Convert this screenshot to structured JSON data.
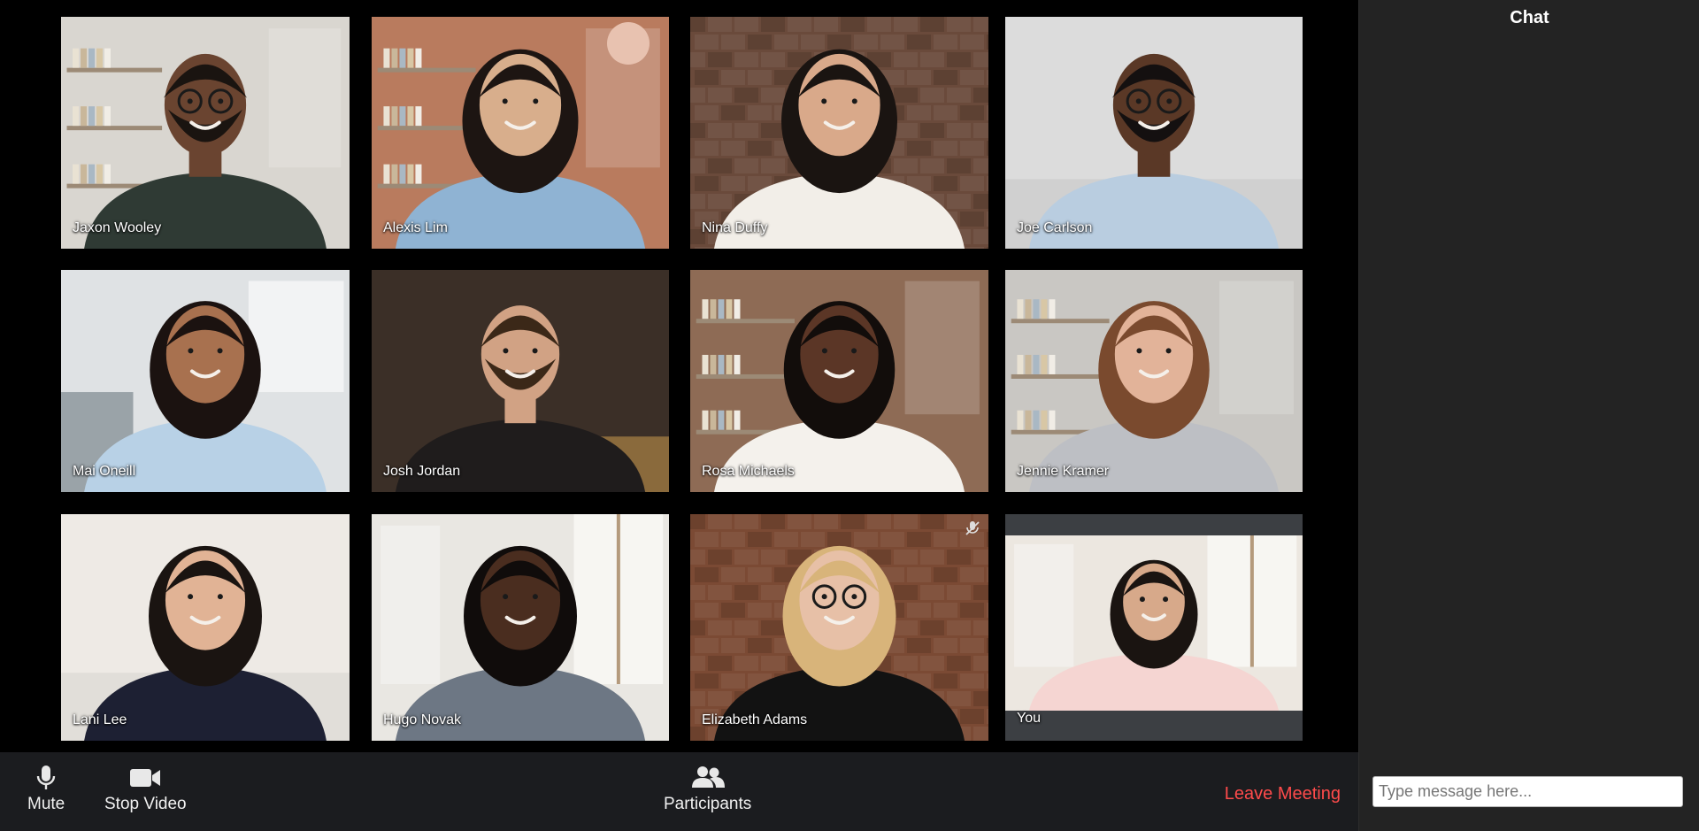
{
  "participants": [
    {
      "name": "Jaxon Wooley",
      "scene": "shelves",
      "bg": "#d9d6d0",
      "skin": "#6a4430",
      "shirt": "#2f3a34",
      "hair": "#1a1410",
      "glasses": true,
      "beard": true
    },
    {
      "name": "Alexis Lim",
      "scene": "bookcase",
      "bg": "#b97b5e",
      "skin": "#d8ae8c",
      "shirt": "#8fb3d3",
      "hair": "#1d1512",
      "glasses": false,
      "beard": false
    },
    {
      "name": "Nina Duffy",
      "scene": "brick",
      "bg": "#6a4a3b",
      "skin": "#d9a98a",
      "shirt": "#f2eee8",
      "hair": "#1a1411",
      "glasses": false,
      "beard": false
    },
    {
      "name": "Joe Carlson",
      "scene": "plain",
      "bg": "#dcdcdc",
      "skin": "#5a3826",
      "shirt": "#b9cde0",
      "hair": "#141010",
      "glasses": true,
      "beard": true
    },
    {
      "name": "Mai Oneill",
      "scene": "office",
      "bg": "#dfe2e4",
      "skin": "#a8714f",
      "shirt": "#b8d1e6",
      "hair": "#1b1210",
      "glasses": false,
      "beard": false
    },
    {
      "name": "Josh Jordan",
      "scene": "dark",
      "bg": "#3b2f27",
      "skin": "#d1a284",
      "shirt": "#1f1c1c",
      "hair": "#3b2818",
      "glasses": false,
      "beard": true
    },
    {
      "name": "Rosa Michaels",
      "scene": "bookcase",
      "bg": "#8e6b55",
      "skin": "#5b3626",
      "shirt": "#f4f1ec",
      "hair": "#120d0b",
      "glasses": false,
      "beard": false
    },
    {
      "name": "Jennie Kramer",
      "scene": "shelves",
      "bg": "#c9c7c3",
      "skin": "#e2b399",
      "shirt": "#bdbfc4",
      "hair": "#7a4a2e",
      "glasses": false,
      "beard": false
    },
    {
      "name": "Lani Lee",
      "scene": "plain",
      "bg": "#eeeae5",
      "skin": "#e1b395",
      "shirt": "#1d2033",
      "hair": "#1a1411",
      "glasses": false,
      "beard": false
    },
    {
      "name": "Hugo Novak",
      "scene": "window",
      "bg": "#e9e7e2",
      "skin": "#4a2d1f",
      "shirt": "#6d7784",
      "hair": "#100c0b",
      "glasses": false,
      "beard": false
    },
    {
      "name": "Elizabeth Adams",
      "scene": "brick",
      "bg": "#7b4a34",
      "skin": "#e7c0a7",
      "shirt": "#121212",
      "hair": "#d8b47a",
      "glasses": true,
      "beard": false
    },
    {
      "name": "You",
      "scene": "window",
      "bg": "#ece7e0",
      "skin": "#d7a98a",
      "shirt": "#f5d5d2",
      "hair": "#1a1411",
      "glasses": false,
      "beard": false
    }
  ],
  "toolbar": {
    "mute_label": "Mute",
    "video_label": "Stop Video",
    "participants_label": "Participants",
    "leave_label": "Leave Meeting"
  },
  "chat": {
    "title": "Chat",
    "placeholder": "Type message here..."
  },
  "colors": {
    "leave": "#ff4b4b",
    "toolbar_bg": "#1b1c1f",
    "chat_bg": "#232323"
  }
}
